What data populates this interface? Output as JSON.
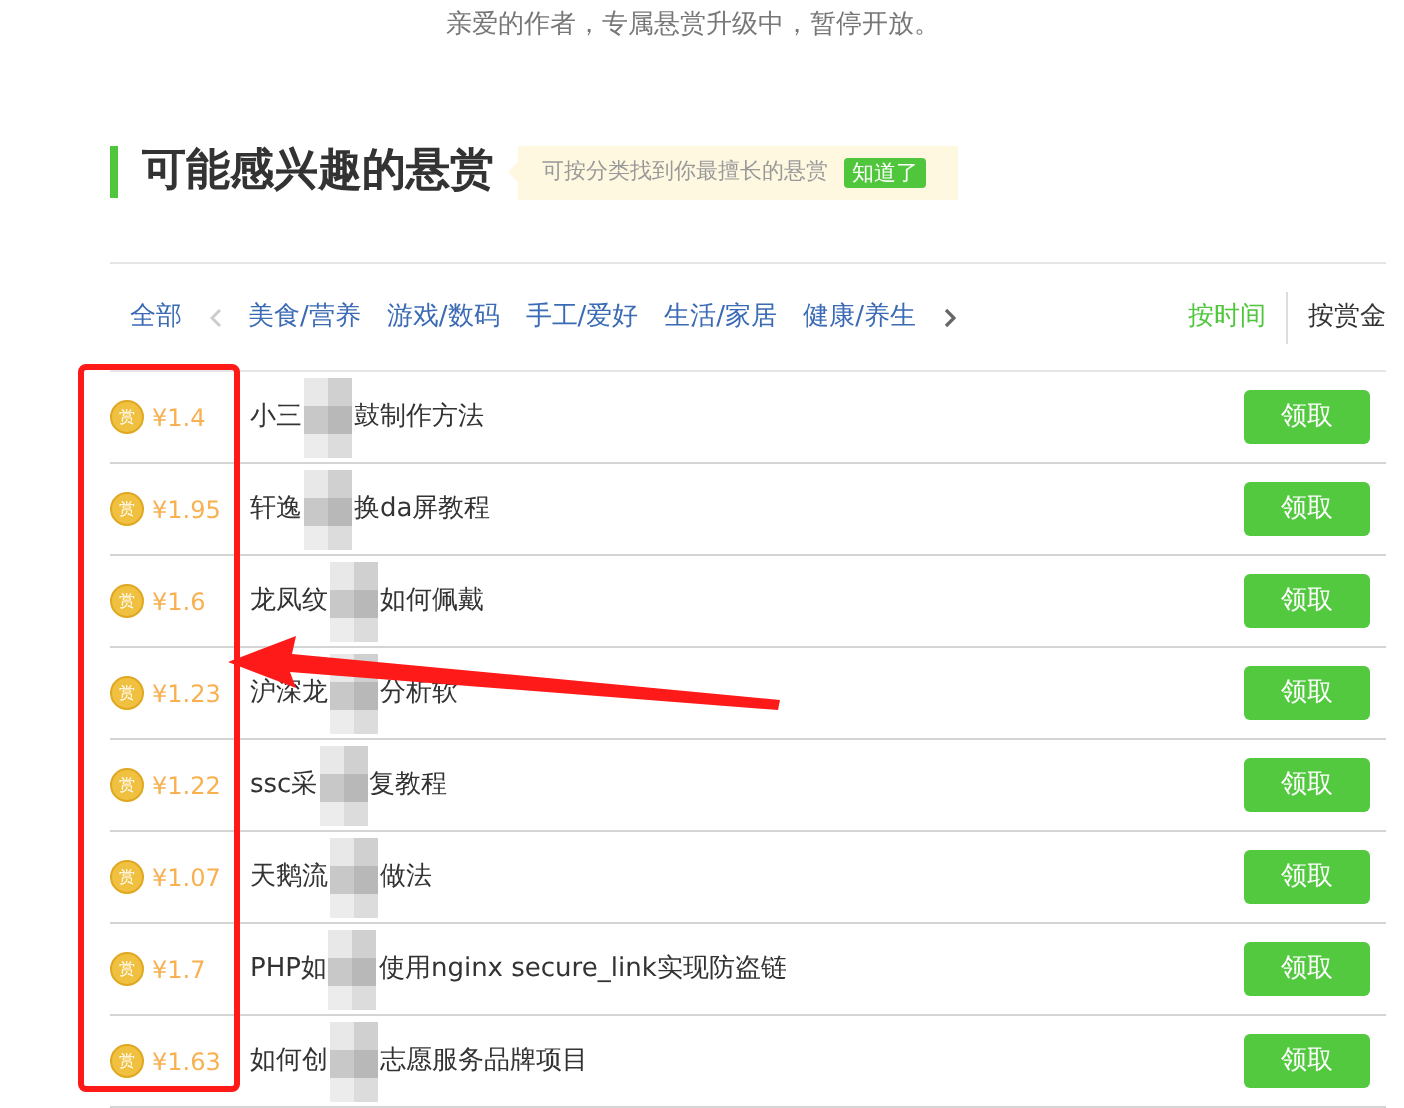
{
  "notice": "亲爱的作者，专属悬赏升级中，暂停开放。",
  "heading": "可能感兴趣的悬赏",
  "tip": {
    "text": "可按分类找到你最擅长的悬赏",
    "button": "知道了"
  },
  "categories": [
    "全部",
    "美食/营养",
    "游戏/数码",
    "手工/爱好",
    "生活/家居",
    "健康/养生"
  ],
  "sort": [
    {
      "label": "按时间",
      "selected": true
    },
    {
      "label": "按赏金",
      "selected": false
    }
  ],
  "rewards": [
    {
      "coin": "赏",
      "price": "¥1.4",
      "title_start": "小三",
      "title_end": "鼓制作方法",
      "button": "领取"
    },
    {
      "coin": "赏",
      "price": "¥1.95",
      "title_start": "轩逸",
      "title_end": "换da屏教程",
      "button": "领取"
    },
    {
      "coin": "赏",
      "price": "¥1.6",
      "title_start": "龙凤纹",
      "title_end": "如何佩戴",
      "button": "领取"
    },
    {
      "coin": "赏",
      "price": "¥1.23",
      "title_start": "沪深龙",
      "title_end": "分析软",
      "button": "领取"
    },
    {
      "coin": "赏",
      "price": "¥1.22",
      "title_start": "ssc采",
      "title_end": "复教程",
      "button": "领取"
    },
    {
      "coin": "赏",
      "price": "¥1.07",
      "title_start": "天鹅流",
      "title_end": "做法",
      "button": "领取"
    },
    {
      "coin": "赏",
      "price": "¥1.7",
      "title_start": "PHP如",
      "title_end": "使用nginx secure_link实现防盗链",
      "button": "领取"
    },
    {
      "coin": "赏",
      "price": "¥1.63",
      "title_start": "如何创",
      "title_end": "志愿服务品牌项目",
      "button": "领取"
    }
  ]
}
